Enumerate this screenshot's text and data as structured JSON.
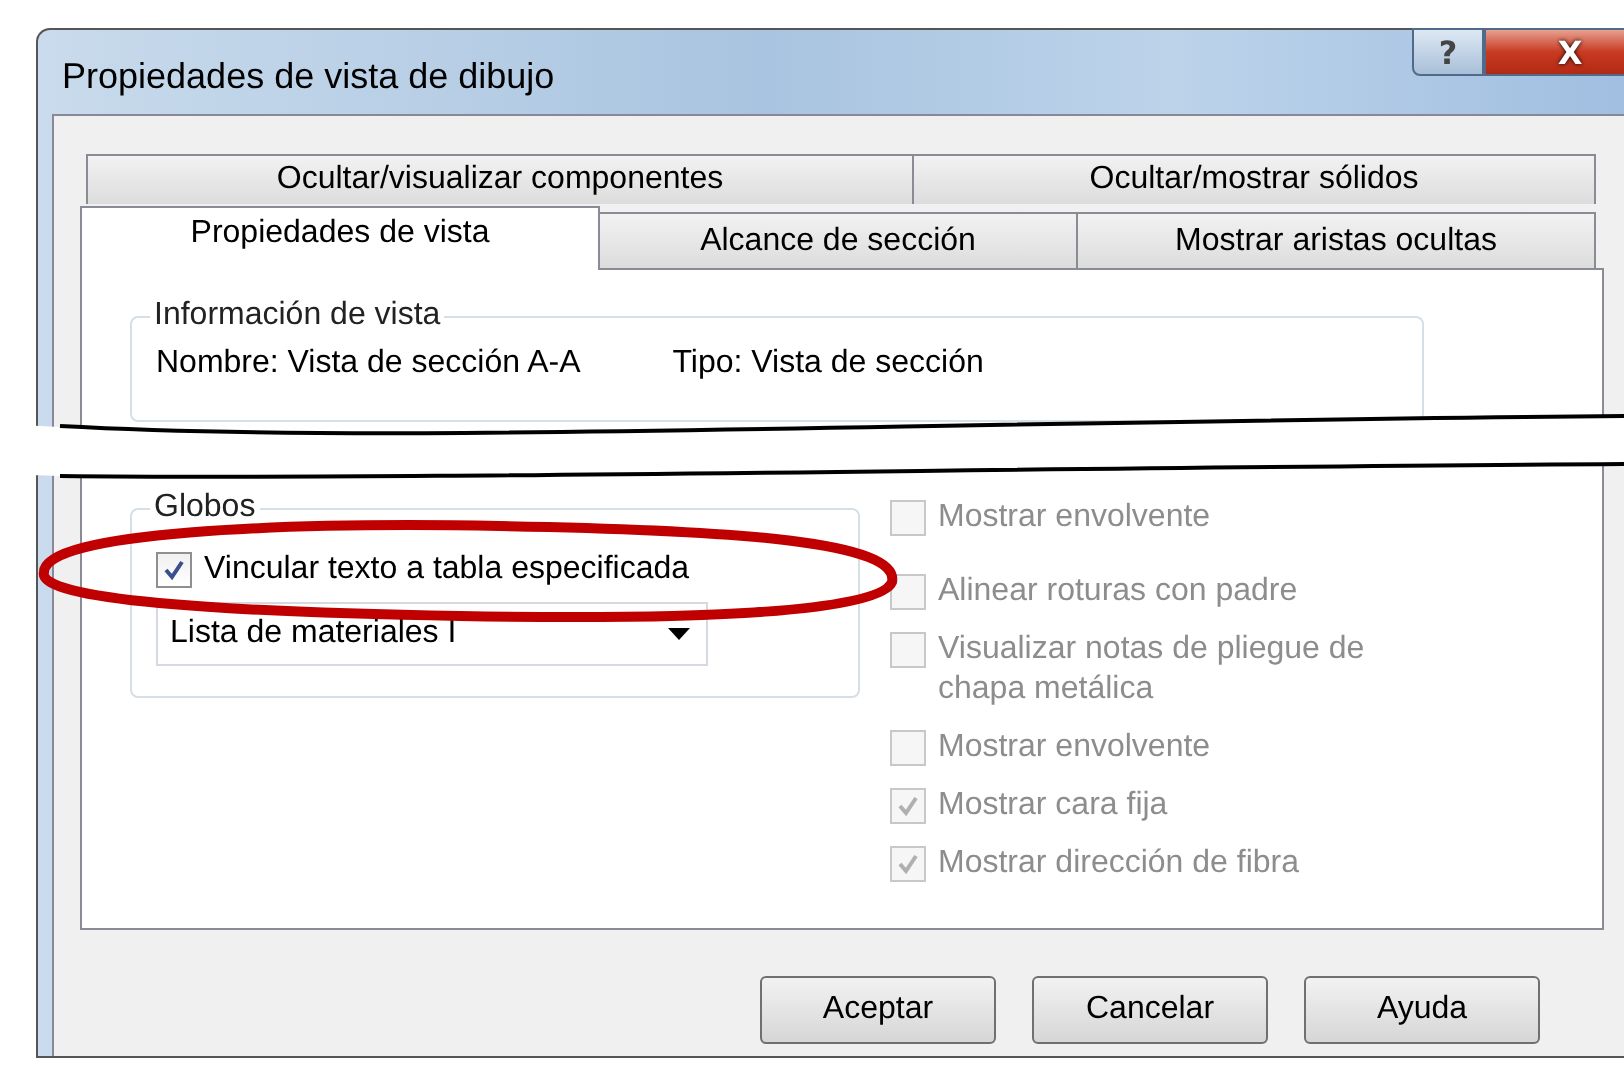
{
  "window": {
    "title": "Propiedades de vista de dibujo",
    "help_button": "?",
    "close_button": "X"
  },
  "tab_rows": [
    [
      {
        "label": "Ocultar/visualizar componentes",
        "selected": false
      },
      {
        "label": "Ocultar/mostrar sólidos",
        "selected": false
      }
    ],
    [
      {
        "label": "Propiedades de vista",
        "selected": true
      },
      {
        "label": "Alcance de sección",
        "selected": false
      },
      {
        "label": "Mostrar aristas ocultas",
        "selected": false
      }
    ]
  ],
  "view_info": {
    "title": "Información de vista",
    "name": "Nombre: Vista de sección A-A",
    "type": "Tipo: Vista de sección"
  },
  "balloons": {
    "title": "Globos",
    "link_option": {
      "label": "Vincular texto a tabla especificada",
      "checked": true,
      "disabled": false
    },
    "table_select": {
      "value": "Lista de materiales I"
    }
  },
  "options": [
    {
      "label": "Mostrar envolvente",
      "checked": false,
      "disabled": true
    },
    {
      "label": "Alinear roturas con padre",
      "checked": false,
      "disabled": true
    },
    {
      "label": "Visualizar notas de pliegue de chapa metálica",
      "checked": false,
      "disabled": true
    },
    {
      "label": "Mostrar envolvente",
      "checked": false,
      "disabled": true
    },
    {
      "label": "Mostrar cara fija",
      "checked": true,
      "disabled": true
    },
    {
      "label": "Mostrar dirección de fibra",
      "checked": true,
      "disabled": true
    }
  ],
  "buttons": [
    "Aceptar",
    "Cancelar",
    "Ayuda"
  ]
}
